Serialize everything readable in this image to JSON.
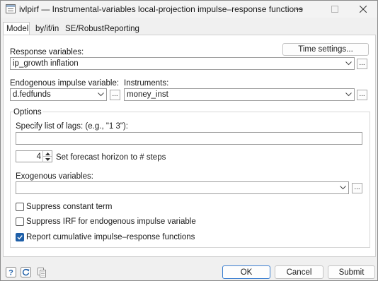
{
  "window": {
    "title": "ivlpirf — Instrumental-variables local-projection impulse–response functions",
    "controls": {
      "minimize_icon": "minimize-icon",
      "maximize_icon": "maximize-icon",
      "close_icon": "close-icon"
    }
  },
  "tabs": [
    {
      "label": "Model",
      "active": true
    },
    {
      "label": "by/if/in",
      "active": false
    },
    {
      "label": "SE/Robust",
      "active": false
    },
    {
      "label": "Reporting",
      "active": false
    }
  ],
  "model": {
    "time_settings_label": "Time settings...",
    "response_label": "Response variables:",
    "response_value": "ip_growth inflation",
    "endogenous_label": "Endogenous impulse variable:",
    "endogenous_value": "d.fedfunds",
    "instruments_label": "Instruments:",
    "instruments_value": "money_inst",
    "ellipsis": "...",
    "options": {
      "title": "Options",
      "lags_label": "Specify list of lags: (e.g., \"1 3\"):",
      "lags_value": "",
      "horizon_value": "4",
      "horizon_label": "Set forecast horizon to # steps",
      "exog_label": "Exogenous variables:",
      "exog_value": "",
      "checkboxes": [
        {
          "label": "Suppress constant term",
          "checked": false
        },
        {
          "label": "Suppress IRF for endogenous impulse variable",
          "checked": false
        },
        {
          "label": "Report cumulative impulse–response functions",
          "checked": true
        }
      ]
    }
  },
  "footer": {
    "help_icon": "help-icon",
    "reset_icon": "reset-icon",
    "copy_icon": "copy-icon",
    "ok_label": "OK",
    "cancel_label": "Cancel",
    "submit_label": "Submit"
  },
  "colors": {
    "accent": "#1f5fa8",
    "button_border": "#c3c3c3",
    "ok_border": "#3c7fd0"
  }
}
